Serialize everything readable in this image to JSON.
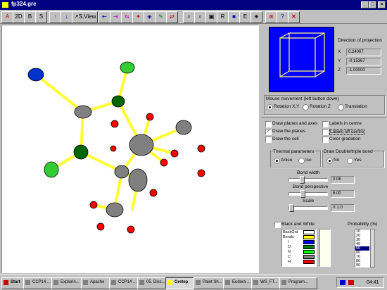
{
  "window": {
    "title": "fp324.gre",
    "min": "_",
    "max": "□",
    "close": "×"
  },
  "toolbar": {
    "groups": [
      "Bi",
      "B",
      "B",
      "S",
      "S.View",
      "R",
      "E"
    ],
    "labels_text": [
      "2D",
      "R",
      "B",
      "S"
    ]
  },
  "projection": {
    "title": "Direction of projection",
    "x_label": "X",
    "x_value": "0.24007",
    "y_label": "Y",
    "y_value": "-0.15367",
    "z_label": "Z",
    "z_value": "-1.00000"
  },
  "mouse": {
    "title": "Mouse movement (left button down)",
    "options": [
      "Rotation X,Y",
      "Rotation Z",
      "Translation"
    ],
    "selected": 0
  },
  "checks": {
    "draw_planes_axes": "Draw planes and axes",
    "draw_planes": "Draw the planes",
    "draw_cell": "Draw the cell",
    "labels_centre": "Labels in centre",
    "labels_off_centre": "Labels off centre",
    "color_gradation": "Color gradation"
  },
  "thermal": {
    "title": "Thermal parameters",
    "options": [
      "Aniso",
      "Iso"
    ],
    "selected": 0
  },
  "bond_draw": {
    "title": "Draw Double/triple bond",
    "options": [
      "No",
      "Yes"
    ],
    "selected": 0
  },
  "sliders": {
    "bond_width": {
      "label": "Bond width",
      "value": "0.06",
      "level": 0.3
    },
    "bond_perspective": {
      "label": "Bond perspective",
      "value": "6.00",
      "level": 0.35
    },
    "scale": {
      "label": "Scale",
      "value": "X 1.0",
      "level": 0.05
    }
  },
  "bw": {
    "label": "Black and White"
  },
  "colors": {
    "headers": [
      "BackGrd",
      "Bonds"
    ],
    "atoms": [
      "I",
      "O",
      "N",
      "C",
      "H"
    ],
    "swatches": [
      "#ffffff",
      "#ffff00",
      "#0000ff",
      "#008000",
      "#00ff00",
      "#808080",
      "#ff0000"
    ]
  },
  "probability": {
    "label": "Probability (%)",
    "options": [
      "10",
      "20",
      "30",
      "40",
      "50",
      "60",
      "70",
      "80",
      "90"
    ],
    "selected": "50"
  },
  "taskbar": {
    "start": "Start",
    "items": [
      "CCP14 ...",
      "Explorin...",
      "Apache",
      "CCP14 ...",
      "05. Disc...",
      "Gretep",
      "Paint Sh...",
      "Eudora ...",
      "WS_FT...",
      "Program..."
    ],
    "active": "Gretep",
    "clock": "04:41"
  },
  "molecule_colors": {
    "bond": "#ffff33",
    "carbon": "#808080",
    "oxygen": "#ff0000",
    "nitrogen": "#006600",
    "chlorine": "#33cc33",
    "iodine": "#0033cc"
  }
}
